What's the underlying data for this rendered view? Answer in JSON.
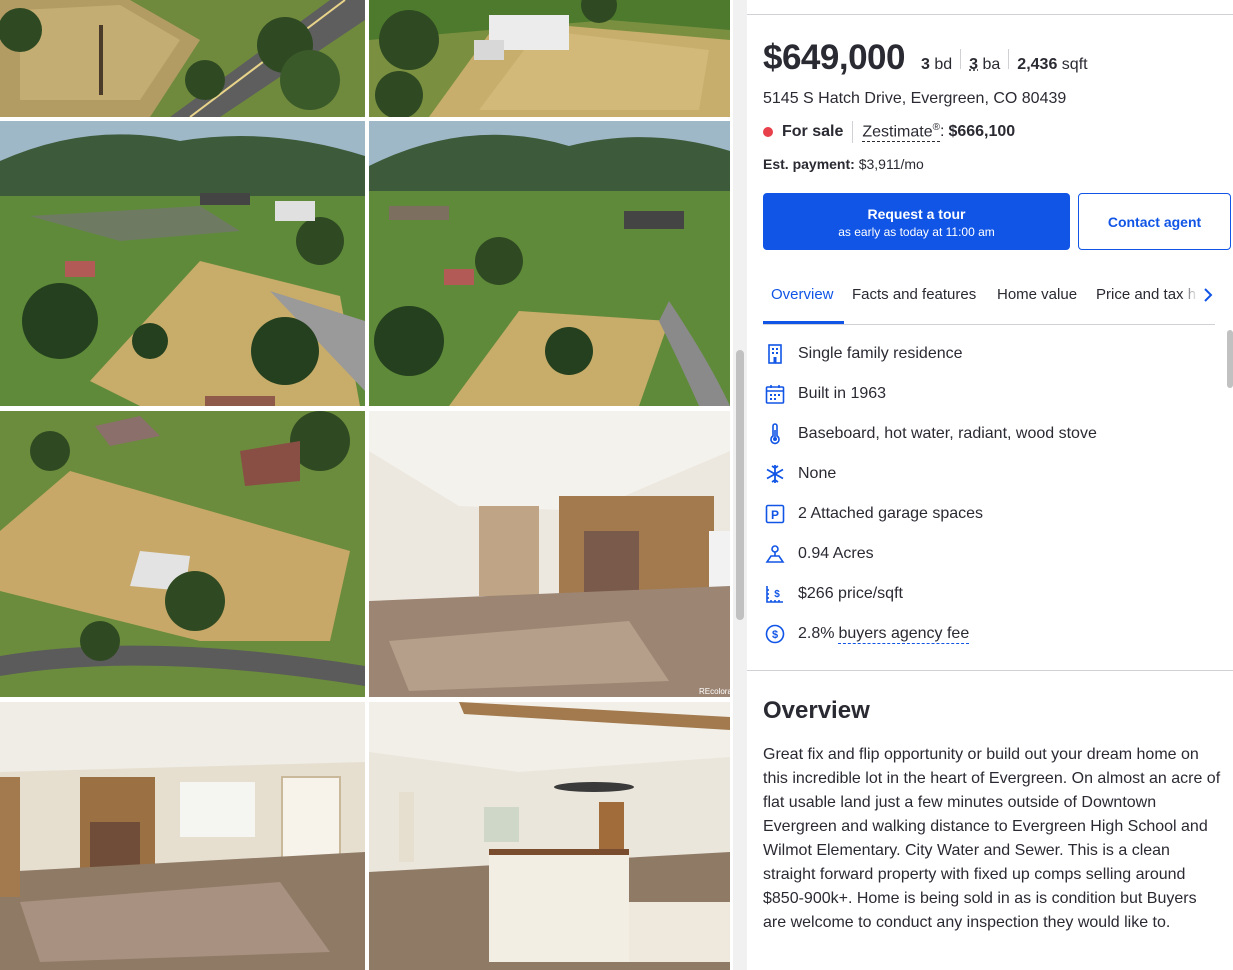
{
  "photos": [
    {
      "alt": "aerial-street-corner"
    },
    {
      "alt": "aerial-house-top"
    },
    {
      "alt": "aerial-valley-1"
    },
    {
      "alt": "aerial-valley-2"
    },
    {
      "alt": "aerial-lot-overhead"
    },
    {
      "alt": "living-room-fireplace",
      "watermark": "REcolorado"
    },
    {
      "alt": "living-room-front-door"
    },
    {
      "alt": "dining-room-ceiling-fan"
    }
  ],
  "listing": {
    "price": "$649,000",
    "beds_num": "3",
    "beds_unit": "bd",
    "baths_num": "3",
    "baths_unit": "ba",
    "sqft_num": "2,436",
    "sqft_unit": "sqft",
    "address": "5145 S Hatch Drive, Evergreen, CO 80439",
    "status": "For sale",
    "zestimate_label": "Zestimate",
    "zestimate_reg": "®",
    "zestimate_colon": ":",
    "zestimate_value": "$666,100",
    "est_payment_label": "Est. payment:",
    "est_payment_value": "$3,911/mo"
  },
  "actions": {
    "tour_label": "Request a tour",
    "tour_sub": "as early as today at 11:00 am",
    "contact_label": "Contact agent"
  },
  "tabs": [
    "Overview",
    "Facts and features",
    "Home value",
    "Price and tax h"
  ],
  "facts": [
    {
      "icon": "building-icon",
      "text": "Single family residence"
    },
    {
      "icon": "calendar-icon",
      "text": "Built in 1963"
    },
    {
      "icon": "thermometer-icon",
      "text": "Baseboard, hot water, radiant, wood stove"
    },
    {
      "icon": "snowflake-icon",
      "text": "None"
    },
    {
      "icon": "parking-icon",
      "text": "2 Attached garage spaces"
    },
    {
      "icon": "lot-size-icon",
      "text": "0.94 Acres"
    },
    {
      "icon": "price-per-sqft-icon",
      "text": "$266 price/sqft"
    },
    {
      "icon": "dollar-circle-icon",
      "text": "2.8%",
      "link": "buyers agency fee"
    }
  ],
  "overview": {
    "title": "Overview",
    "description": "Great fix and flip opportunity or build out your dream home on this incredible lot in the heart of Evergreen. On almost an acre of flat usable land just a few minutes outside of Downtown Evergreen and walking distance to Evergreen High School and Wilmot Elementary. City Water and Sewer. This is a clean straight forward property with fixed up comps selling around $850-900k+. Home is being sold in as is condition but Buyers are welcome to conduct any inspection they would like to."
  },
  "colors": {
    "accent": "#1155e6",
    "status_dot": "#e8414b",
    "text": "#2a2a33"
  }
}
